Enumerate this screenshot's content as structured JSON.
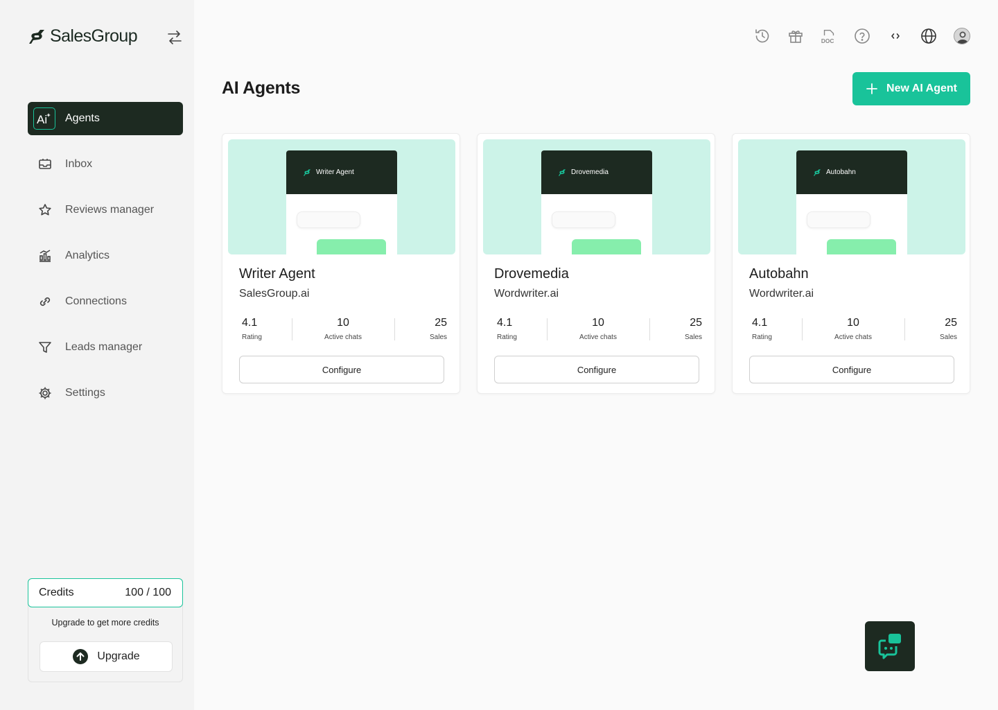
{
  "brand": {
    "name": "SalesGroup",
    "accent": "#19c39a",
    "dark": "#1d2a21"
  },
  "sidebar": {
    "items": [
      {
        "label": "Agents",
        "icon": "ai-icon",
        "active": true
      },
      {
        "label": "Inbox",
        "icon": "inbox-icon"
      },
      {
        "label": "Reviews manager",
        "icon": "star-icon"
      },
      {
        "label": "Analytics",
        "icon": "analytics-icon"
      },
      {
        "label": "Connections",
        "icon": "link-icon"
      },
      {
        "label": "Leads manager",
        "icon": "filter-icon"
      },
      {
        "label": "Settings",
        "icon": "gear-icon"
      }
    ],
    "credits": {
      "label": "Credits",
      "value": "100 / 100",
      "note": "Upgrade to get more credits",
      "upgrade_label": "Upgrade"
    }
  },
  "topbar": {
    "icons": [
      "history-icon",
      "gift-icon",
      "doc-icon",
      "help-icon",
      "code-icon",
      "globe-icon",
      "avatar"
    ]
  },
  "main": {
    "title": "AI Agents",
    "new_button": "New AI Agent",
    "cards": [
      {
        "preview_title": "Writer Agent",
        "name": "Writer Agent",
        "domain": "SalesGroup.ai",
        "stats": [
          {
            "value": "4.1",
            "label": "Rating"
          },
          {
            "value": "10",
            "label": "Active chats"
          },
          {
            "value": "25",
            "label": "Sales"
          }
        ],
        "configure": "Configure"
      },
      {
        "preview_title": "Drovemedia",
        "name": "Drovemedia",
        "domain": "Wordwriter.ai",
        "stats": [
          {
            "value": "4.1",
            "label": "Rating"
          },
          {
            "value": "10",
            "label": "Active chats"
          },
          {
            "value": "25",
            "label": "Sales"
          }
        ],
        "configure": "Configure"
      },
      {
        "preview_title": "Autobahn",
        "name": "Autobahn",
        "domain": "Wordwriter.ai",
        "stats": [
          {
            "value": "4.1",
            "label": "Rating"
          },
          {
            "value": "10",
            "label": "Active chats"
          },
          {
            "value": "25",
            "label": "Sales"
          }
        ],
        "configure": "Configure"
      }
    ]
  }
}
